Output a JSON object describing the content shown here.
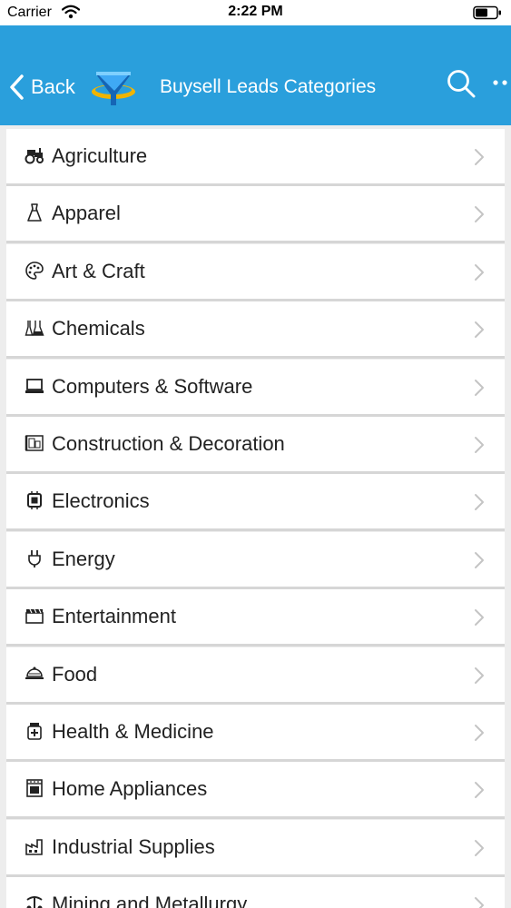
{
  "status_bar": {
    "carrier": "Carrier",
    "time": "2:22 PM"
  },
  "nav": {
    "back_label": "Back",
    "title": "Buysell Leads Categories",
    "color": "#2a9fdc"
  },
  "categories": [
    {
      "label": "Agriculture",
      "icon": "tractor-icon"
    },
    {
      "label": "Apparel",
      "icon": "dress-icon"
    },
    {
      "label": "Art & Craft",
      "icon": "palette-icon"
    },
    {
      "label": "Chemicals",
      "icon": "flask-icon"
    },
    {
      "label": "Computers & Software",
      "icon": "laptop-icon"
    },
    {
      "label": "Construction & Decoration",
      "icon": "blueprint-icon"
    },
    {
      "label": "Electronics",
      "icon": "chip-icon"
    },
    {
      "label": "Energy",
      "icon": "plug-icon"
    },
    {
      "label": "Entertainment",
      "icon": "clapperboard-icon"
    },
    {
      "label": "Food",
      "icon": "food-platter-icon"
    },
    {
      "label": "Health & Medicine",
      "icon": "medicine-bottle-icon"
    },
    {
      "label": "Home Appliances",
      "icon": "oven-icon"
    },
    {
      "label": "Industrial Supplies",
      "icon": "factory-icon"
    },
    {
      "label": "Mining and Metallurgy",
      "icon": "mining-icon"
    }
  ]
}
